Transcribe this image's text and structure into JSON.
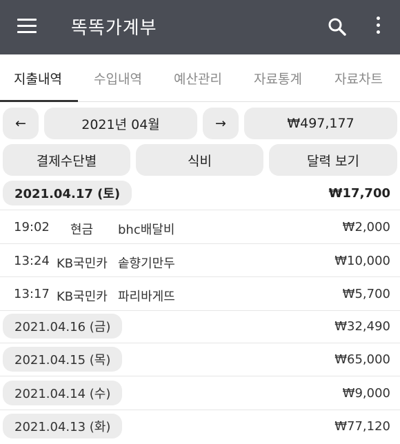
{
  "app": {
    "title": "똑똑가계부"
  },
  "tabs": [
    "지출내역",
    "수입내역",
    "예산관리",
    "자료통계",
    "자료차트"
  ],
  "nav": {
    "prev": "←",
    "month": "2021년 04월",
    "next": "→",
    "total": "₩497,177"
  },
  "filters": [
    "결제수단별",
    "식비",
    "달력 보기"
  ],
  "current_day": {
    "date": "2021.04.17 (토)",
    "total": "₩17,700"
  },
  "transactions": [
    {
      "time": "19:02",
      "method": "현금",
      "desc": "bhc배달비",
      "amount": "₩2,000"
    },
    {
      "time": "13:24",
      "method": "KB국민카",
      "desc": "솥향기만두",
      "amount": "₩10,000"
    },
    {
      "time": "13:17",
      "method": "KB국민카",
      "desc": "파리바게뜨",
      "amount": "₩5,700"
    }
  ],
  "days": [
    {
      "date": "2021.04.16 (금)",
      "total": "₩32,490"
    },
    {
      "date": "2021.04.15 (목)",
      "total": "₩65,000"
    },
    {
      "date": "2021.04.14 (수)",
      "total": "₩9,000"
    },
    {
      "date": "2021.04.13 (화)",
      "total": "₩77,120"
    }
  ]
}
